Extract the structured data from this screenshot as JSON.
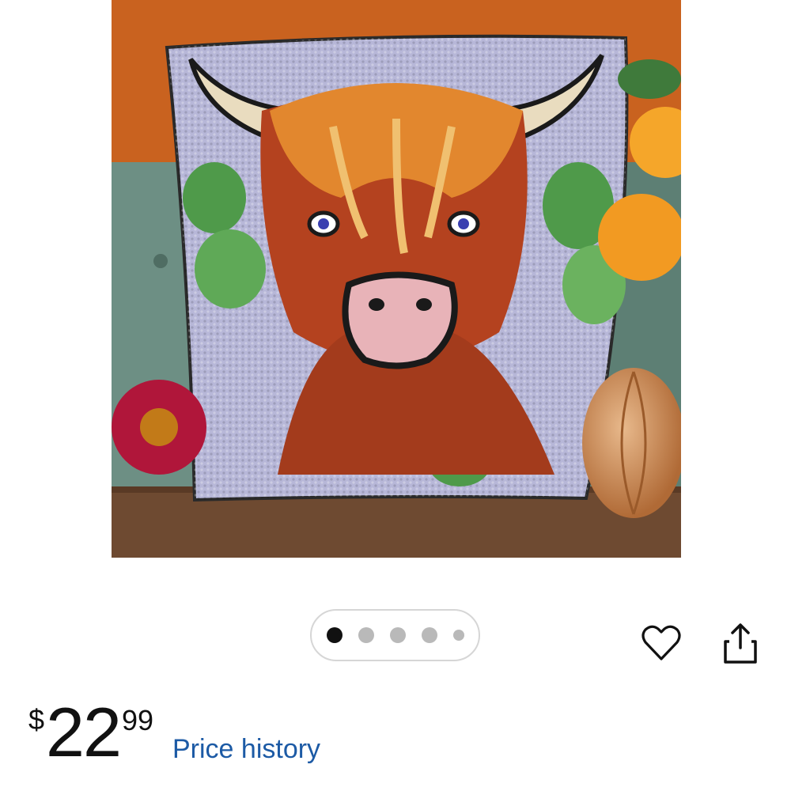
{
  "product": {
    "image_alt": "Latch hook kit pillow with a highland cow design",
    "image_count": 5,
    "active_image_index": 0
  },
  "actions": {
    "favorite_icon": "heart-outline-icon",
    "share_icon": "share-icon"
  },
  "price": {
    "currency_symbol": "$",
    "dollars": "22",
    "cents": "99"
  },
  "price_history_link": "Price history",
  "colors": {
    "link": "#1c5aa5",
    "dot_active": "#111111",
    "dot_inactive": "#b9b9b9"
  }
}
